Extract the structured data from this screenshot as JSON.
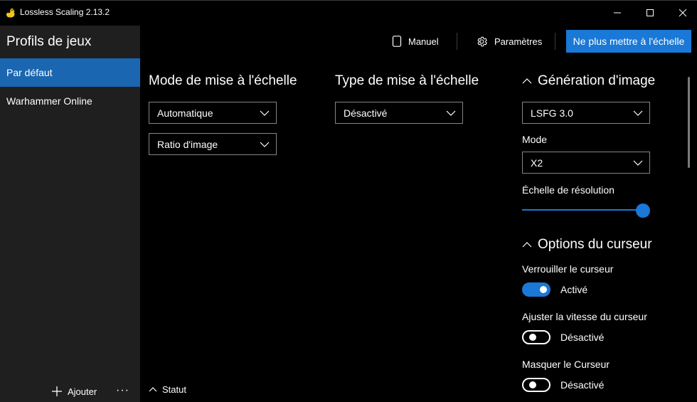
{
  "window": {
    "title": "Lossless Scaling 2.13.2",
    "controls": [
      "minimize",
      "maximize",
      "close"
    ]
  },
  "sidebar": {
    "title": "Profils de jeux",
    "profiles": [
      {
        "label": "Par défaut",
        "active": true
      },
      {
        "label": "Warhammer Online",
        "active": false
      }
    ],
    "add_label": "Ajouter",
    "more_label": "···"
  },
  "header": {
    "manual_label": "Manuel",
    "settings_label": "Paramètres",
    "primary_label": "Ne plus mettre à l'échelle"
  },
  "scaling_mode": {
    "title": "Mode de mise à l'échelle",
    "mode_value": "Automatique",
    "ratio_value": "Ratio d'image"
  },
  "scaling_type": {
    "title": "Type de mise à l'échelle",
    "value": "Désactivé"
  },
  "frame_generation": {
    "title": "Génération d'image",
    "value": "LSFG 3.0",
    "mode_label": "Mode",
    "mode_value": "X2",
    "resolution_label": "Échelle de résolution",
    "resolution_scale": 1.0
  },
  "cursor_options": {
    "title": "Options du curseur",
    "items": [
      {
        "label": "Verrouiller le curseur",
        "state": "Activé",
        "on": true
      },
      {
        "label": "Ajuster la vitesse du curseur",
        "state": "Désactivé",
        "on": false
      },
      {
        "label": "Masquer le Curseur",
        "state": "Désactivé",
        "on": false
      }
    ]
  },
  "status": {
    "label": "Statut"
  },
  "colors": {
    "accent": "#1a78d6",
    "selected": "#1a66b0",
    "sidebar_bg": "#1f1f1f",
    "background": "#000000"
  },
  "icons": {
    "app": "duck-icon",
    "manual": "document-icon",
    "settings": "gear-icon",
    "add": "plus-icon",
    "collapse": "chevron-up-icon",
    "dropdown": "chevron-down-icon"
  }
}
